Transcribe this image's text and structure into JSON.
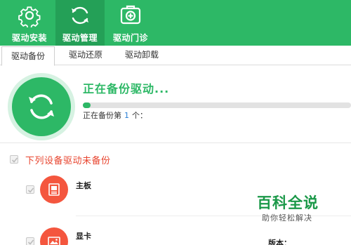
{
  "toolbar": {
    "items": [
      {
        "label": "驱动安装",
        "icon": "gear-icon"
      },
      {
        "label": "驱动管理",
        "icon": "refresh-icon"
      },
      {
        "label": "驱动门诊",
        "icon": "medical-kit-icon"
      }
    ],
    "active_index": 1,
    "color": "#2db866"
  },
  "tabs": [
    {
      "label": "驱动备份"
    },
    {
      "label": "驱动还原"
    },
    {
      "label": "驱动卸载"
    }
  ],
  "status": {
    "title": "正在备份驱动...",
    "progress_percent": 3,
    "progress_prefix": "正在备份第",
    "progress_count": "1",
    "progress_suffix": "个："
  },
  "section": {
    "title": "下列设备驱动未备份",
    "checked": true,
    "devices": [
      {
        "name": "主板",
        "icon": "motherboard-icon",
        "checked": true
      },
      {
        "name": "显卡",
        "icon": "display-card-icon",
        "checked": true
      }
    ]
  },
  "version_label": "版本：",
  "watermark": {
    "title": "百科全说",
    "subtitle": "助你轻松解决"
  },
  "colors": {
    "accent_green": "#2db866",
    "alert_red": "#e8452f",
    "device_icon_bg": "#f4563e",
    "link_blue": "#2a7fd4"
  }
}
